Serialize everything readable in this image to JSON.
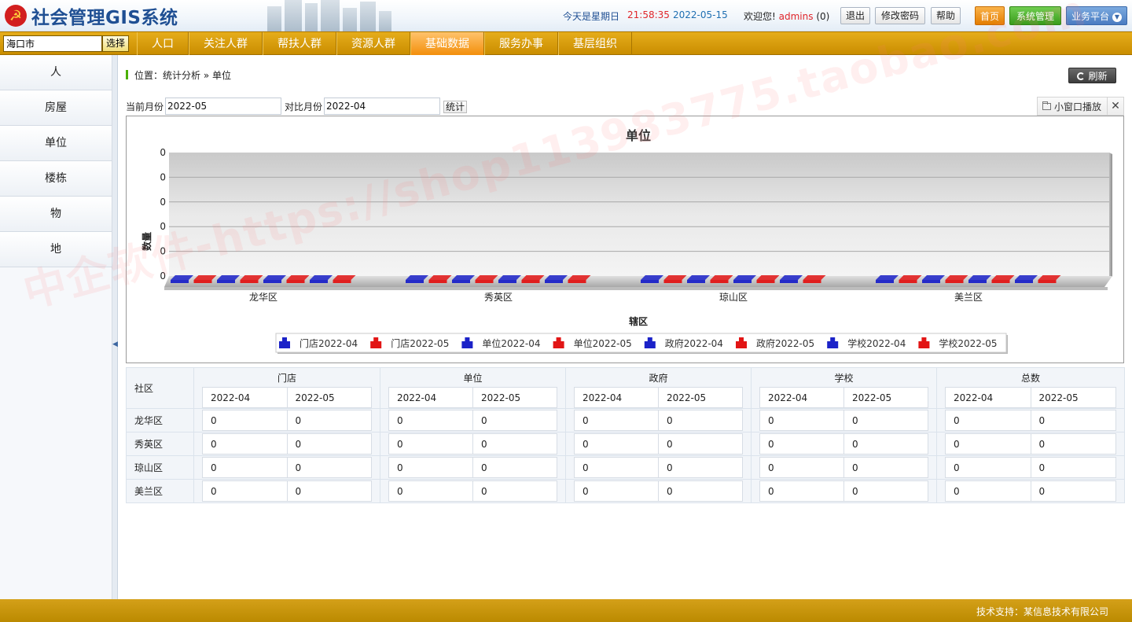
{
  "header": {
    "app_title": "社会管理GIS系统",
    "weekday_text": "今天是星期日",
    "time_text": "21:58:35",
    "date_text": "2022-05-15",
    "welcome_prefix": "欢迎您!",
    "username": "admins",
    "message_count": "(0)",
    "logout_label": "退出",
    "change_password_label": "修改密码",
    "help_label": "帮助",
    "home_label": "首页",
    "system_label": "系统管理",
    "business_label": "业务平台",
    "colors": {
      "brand_blue": "#1f4f93",
      "time_red": "#e0262b",
      "nav_gold": "#c98d00"
    }
  },
  "nav": {
    "city_value": "海口市",
    "select_label": "选择",
    "items": [
      {
        "label": "人口",
        "active": false
      },
      {
        "label": "关注人群",
        "active": false
      },
      {
        "label": "帮扶人群",
        "active": false
      },
      {
        "label": "资源人群",
        "active": false
      },
      {
        "label": "基础数据",
        "active": true
      },
      {
        "label": "服务办事",
        "active": false
      },
      {
        "label": "基层组织",
        "active": false
      }
    ]
  },
  "sidebar": {
    "items": [
      {
        "label": "人"
      },
      {
        "label": "房屋"
      },
      {
        "label": "单位"
      },
      {
        "label": "楼栋"
      },
      {
        "label": "物"
      },
      {
        "label": "地"
      }
    ]
  },
  "breadcrumb": "位置：统计分析 » 单位",
  "refresh_label": "刷新",
  "filter": {
    "current_month_label": "当前月份",
    "current_month_value": "2022-05",
    "compare_month_label": "对比月份",
    "compare_month_value": "2022-04",
    "stat_button": "统计"
  },
  "popout": {
    "label": "小窗口播放",
    "close": "✕"
  },
  "chart_data": {
    "type": "bar",
    "title": "单位",
    "xlabel": "辖区",
    "ylabel": "数量",
    "categories": [
      "龙华区",
      "秀英区",
      "琼山区",
      "美兰区"
    ],
    "y_tick_labels": [
      "0",
      "0",
      "0",
      "0",
      "0",
      "0"
    ],
    "series": [
      {
        "name": "门店2022-04",
        "values": [
          0,
          0,
          0,
          0
        ],
        "color": "#1b22c8"
      },
      {
        "name": "门店2022-05",
        "values": [
          0,
          0,
          0,
          0
        ],
        "color": "#e21515"
      },
      {
        "name": "单位2022-04",
        "values": [
          0,
          0,
          0,
          0
        ],
        "color": "#1b22c8"
      },
      {
        "name": "单位2022-05",
        "values": [
          0,
          0,
          0,
          0
        ],
        "color": "#e21515"
      },
      {
        "name": "政府2022-04",
        "values": [
          0,
          0,
          0,
          0
        ],
        "color": "#1b22c8"
      },
      {
        "name": "政府2022-05",
        "values": [
          0,
          0,
          0,
          0
        ],
        "color": "#e21515"
      },
      {
        "name": "学校2022-04",
        "values": [
          0,
          0,
          0,
          0
        ],
        "color": "#1b22c8"
      },
      {
        "name": "学校2022-05",
        "values": [
          0,
          0,
          0,
          0
        ],
        "color": "#e21515"
      }
    ],
    "legend": "bottom",
    "grid": true
  },
  "table": {
    "community_header": "社区",
    "groups": [
      "门店",
      "单位",
      "政府",
      "学校",
      "总数"
    ],
    "months": [
      "2022-04",
      "2022-05"
    ],
    "rows": [
      {
        "name": "龙华区",
        "values": [
          "0",
          "0",
          "0",
          "0",
          "0",
          "0",
          "0",
          "0",
          "0",
          "0"
        ]
      },
      {
        "name": "秀英区",
        "values": [
          "0",
          "0",
          "0",
          "0",
          "0",
          "0",
          "0",
          "0",
          "0",
          "0"
        ]
      },
      {
        "name": "琼山区",
        "values": [
          "0",
          "0",
          "0",
          "0",
          "0",
          "0",
          "0",
          "0",
          "0",
          "0"
        ]
      },
      {
        "name": "美兰区",
        "values": [
          "0",
          "0",
          "0",
          "0",
          "0",
          "0",
          "0",
          "0",
          "0",
          "0"
        ]
      }
    ]
  },
  "footer": {
    "text": "技术支持：某信息技术有限公司"
  },
  "watermark": "中企软件-https://shop113983775.taobao.com"
}
